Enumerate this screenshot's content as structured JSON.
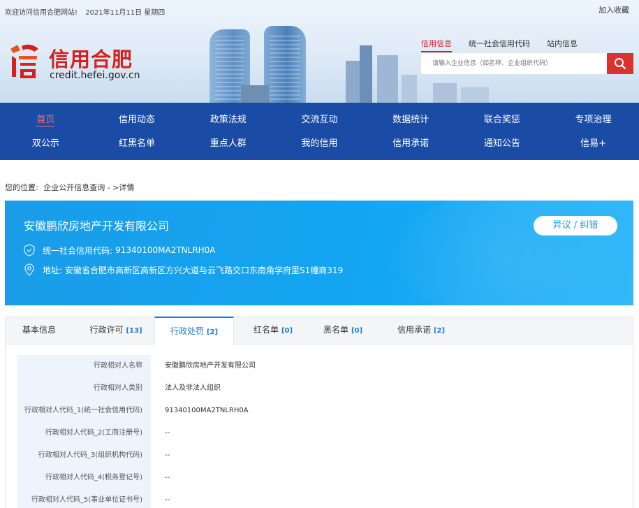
{
  "header": {
    "welcome": "欢迎访问信用合肥网站!",
    "date": "2021年11月11日 星期四",
    "favorite": "加入收藏",
    "logo_title": "信用合肥",
    "logo_url": "credit.hefei.gov.cn"
  },
  "search": {
    "tabs": [
      "信用信息",
      "统一社会信用代码",
      "站内信息"
    ],
    "placeholder": "请输入企业信息（如名称、企业组织代码）"
  },
  "nav": {
    "row1": [
      "首页",
      "信用动态",
      "政策法规",
      "交流互动",
      "数据统计",
      "联合奖惩",
      "专项治理"
    ],
    "row2": [
      "双公示",
      "红黑名单",
      "重点人群",
      "我的信用",
      "信用承诺",
      "通知公告",
      "信易+"
    ]
  },
  "breadcrumb": {
    "prefix": "您的位置:",
    "path": "企业公开信息查询 - >详情"
  },
  "company": {
    "name": "安徽鹏欣房地产开发有限公司",
    "dispute_button": "异议 / 纠错",
    "credit_code_label": "统一社会信用代码:",
    "credit_code": "91340100MA2TNLRH0A",
    "address_label": "地址:",
    "address": "安徽省合肥市高新区高新区方兴大道与云飞路交口东南角学府里S1幢商319"
  },
  "tabs": [
    {
      "label": "基本信息",
      "count": ""
    },
    {
      "label": "行政许可",
      "count": "[13]"
    },
    {
      "label": "行政处罚",
      "count": "[2]"
    },
    {
      "label": "红名单",
      "count": "[0]"
    },
    {
      "label": "黑名单",
      "count": "[0]"
    },
    {
      "label": "信用承诺",
      "count": "[2]"
    }
  ],
  "detail_rows": [
    {
      "label": "行政相对人名称",
      "value": "安徽鹏欣房地产开发有限公司"
    },
    {
      "label": "行政相对人类别",
      "value": "法人及非法人组织"
    },
    {
      "label": "行政相对人代码_1(统一社会信用代码)",
      "value": "91340100MA2TNLRH0A"
    },
    {
      "label": "行政相对人代码_2(工商注册号)",
      "value": "--"
    },
    {
      "label": "行政相对人代码_3(组织机构代码)",
      "value": "--"
    },
    {
      "label": "行政相对人代码_4(税务登记号)",
      "value": "--"
    },
    {
      "label": "行政相对人代码_5(事业单位证书号)",
      "value": "--"
    }
  ],
  "colors": {
    "nav_bg": "#1b4ca5",
    "brand_red": "#d6201d",
    "banner_blue": "#13a6f3",
    "tab_accent": "#1a7ad6"
  }
}
